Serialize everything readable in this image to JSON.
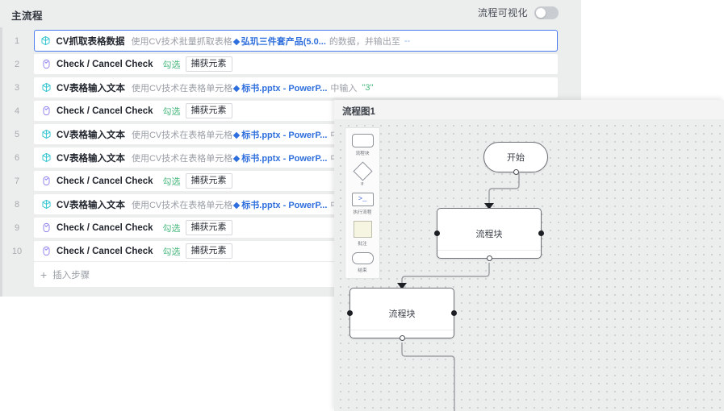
{
  "workflow": {
    "title": "主流程",
    "visualize_label": "流程可视化",
    "visualize_toggle_state": "off",
    "insert_step_label": "插入步骤",
    "capture_button_label": "捕获元素",
    "steps": [
      {
        "index": "1",
        "icon": "cv-cube-icon",
        "name": "CV抓取表格数据",
        "selected": true,
        "tokens": [
          {
            "type": "desc",
            "text": "使用CV技术批量抓取表格"
          },
          {
            "type": "element",
            "text": "弘玑三件套产品(5.0..."
          },
          {
            "type": "plain",
            "text": "的数据，并输出至"
          },
          {
            "type": "dash",
            "text": "--"
          }
        ]
      },
      {
        "index": "2",
        "icon": "check-square-icon",
        "name": "Check / Cancel Check",
        "selected": false,
        "tokens": [
          {
            "type": "green",
            "text": "勾选"
          },
          {
            "type": "button",
            "text": "捕获元素"
          }
        ]
      },
      {
        "index": "3",
        "icon": "cv-cube-icon",
        "name": "CV表格输入文本",
        "selected": false,
        "tokens": [
          {
            "type": "desc",
            "text": "使用CV技术在表格单元格"
          },
          {
            "type": "element",
            "text": "标书.pptx - PowerP..."
          },
          {
            "type": "plain",
            "text": "中输入"
          },
          {
            "type": "green",
            "text": "\"3\""
          }
        ]
      },
      {
        "index": "4",
        "icon": "check-square-icon",
        "name": "Check / Cancel Check",
        "selected": false,
        "tokens": [
          {
            "type": "green",
            "text": "勾选"
          },
          {
            "type": "button",
            "text": "捕获元素"
          }
        ]
      },
      {
        "index": "5",
        "icon": "cv-cube-icon",
        "name": "CV表格输入文本",
        "selected": false,
        "tokens": [
          {
            "type": "desc",
            "text": "使用CV技术在表格单元格"
          },
          {
            "type": "element",
            "text": "标书.pptx - PowerP..."
          },
          {
            "type": "plain",
            "text": "中输入"
          }
        ]
      },
      {
        "index": "6",
        "icon": "cv-cube-icon",
        "name": "CV表格输入文本",
        "selected": false,
        "tokens": [
          {
            "type": "desc",
            "text": "使用CV技术在表格单元格"
          },
          {
            "type": "element",
            "text": "标书.pptx - PowerP..."
          },
          {
            "type": "plain",
            "text": "中输入"
          }
        ]
      },
      {
        "index": "7",
        "icon": "check-square-icon",
        "name": "Check / Cancel Check",
        "selected": false,
        "tokens": [
          {
            "type": "green",
            "text": "勾选"
          },
          {
            "type": "button",
            "text": "捕获元素"
          }
        ]
      },
      {
        "index": "8",
        "icon": "cv-cube-icon",
        "name": "CV表格输入文本",
        "selected": false,
        "tokens": [
          {
            "type": "desc",
            "text": "使用CV技术在表格单元格"
          },
          {
            "type": "element",
            "text": "标书.pptx - PowerP..."
          },
          {
            "type": "plain",
            "text": "中输入"
          }
        ]
      },
      {
        "index": "9",
        "icon": "check-square-icon",
        "name": "Check / Cancel Check",
        "selected": false,
        "tokens": [
          {
            "type": "green",
            "text": "勾选"
          },
          {
            "type": "button",
            "text": "捕获元素"
          }
        ]
      },
      {
        "index": "10",
        "icon": "check-square-icon",
        "name": "Check / Cancel Check",
        "selected": false,
        "tokens": [
          {
            "type": "green",
            "text": "勾选"
          },
          {
            "type": "button",
            "text": "捕获元素"
          }
        ]
      }
    ]
  },
  "flowchart": {
    "title": "流程图1",
    "palette": [
      {
        "shape": "rect",
        "label": "流程块",
        "name": "palette-process-block"
      },
      {
        "shape": "diamond",
        "label": "If",
        "name": "palette-if"
      },
      {
        "shape": "script",
        "label": "执行流程",
        "name": "palette-run-flow",
        "glyph": ">_"
      },
      {
        "shape": "note",
        "label": "批注",
        "name": "palette-note"
      },
      {
        "shape": "end",
        "label": "结束",
        "name": "palette-end"
      }
    ],
    "nodes": [
      {
        "id": "start",
        "label": "开始",
        "shape": "stadium"
      },
      {
        "id": "block-1",
        "label": "流程块",
        "shape": "rounded-rect"
      },
      {
        "id": "block-2",
        "label": "流程块",
        "shape": "rounded-rect"
      }
    ]
  },
  "colors": {
    "accent_blue": "#4c7df0",
    "element_token": "#2f6fdd",
    "green_token": "#49b87e",
    "panel_bg": "#eceded",
    "canvas_bg": "#eceded",
    "cv_icon": "#2ec4cf",
    "check_icon": "#8a7ef0"
  }
}
